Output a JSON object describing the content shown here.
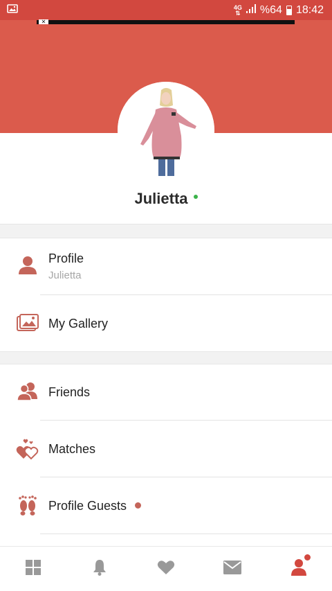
{
  "status_bar": {
    "network": "4G",
    "battery_percent": "%64",
    "time": "18:42"
  },
  "profile": {
    "name": "Julietta",
    "online": true
  },
  "menu_group_1": [
    {
      "label": "Profile",
      "sublabel": "Julietta",
      "icon": "person-icon"
    },
    {
      "label": "My Gallery",
      "icon": "gallery-icon"
    }
  ],
  "menu_group_2": [
    {
      "label": "Friends",
      "icon": "friends-icon"
    },
    {
      "label": "Matches",
      "icon": "matches-hearts-icon"
    },
    {
      "label": "Profile Guests",
      "icon": "footprints-icon",
      "has_new": true
    }
  ],
  "bottom_nav": [
    {
      "name": "dashboard",
      "icon": "grid-icon",
      "active": false
    },
    {
      "name": "notifications",
      "icon": "bell-icon",
      "active": false
    },
    {
      "name": "likes",
      "icon": "heart-icon",
      "active": false
    },
    {
      "name": "messages",
      "icon": "mail-icon",
      "active": false
    },
    {
      "name": "profile",
      "icon": "person-icon",
      "active": true,
      "badge": true
    }
  ],
  "colors": {
    "status_bar": "#d2483f",
    "header": "#db5b4c",
    "accent_icon": "#c4655a",
    "nav_inactive": "#999999",
    "nav_active": "#d2483f",
    "online": "#3bb34a"
  }
}
